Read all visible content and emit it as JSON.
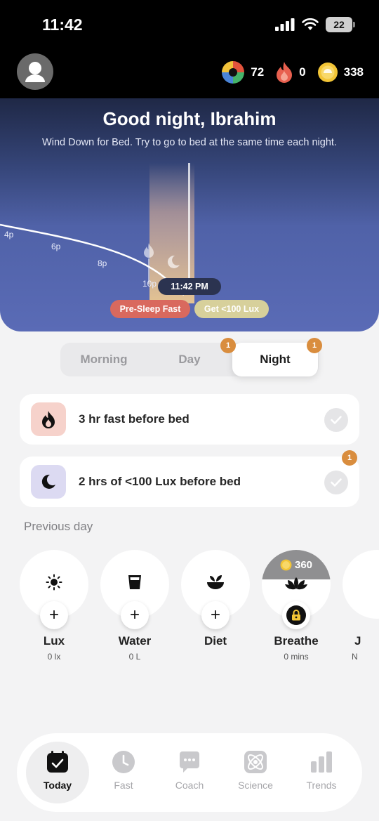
{
  "status_bar": {
    "time": "11:42",
    "battery": "22"
  },
  "header": {
    "stats": [
      {
        "icon": "color-wheel-icon",
        "value": "72"
      },
      {
        "icon": "flame-icon",
        "value": "0"
      },
      {
        "icon": "coin-icon",
        "value": "338"
      }
    ]
  },
  "hero": {
    "title": "Good night, Ibrahim",
    "subtitle": "Wind Down for Bed. Try to go to bed at the same time each night.",
    "time_labels": [
      "4p",
      "6p",
      "8p",
      "10p"
    ],
    "current_time": "11:42 PM",
    "tags": [
      "Pre-Sleep Fast",
      "Get <100 Lux"
    ]
  },
  "segment": {
    "tabs": [
      "Morning",
      "Day",
      "Night"
    ],
    "selected": "Night",
    "badges": {
      "day": "1",
      "night": "1"
    }
  },
  "tasks": [
    {
      "label": "3 hr fast before bed",
      "icon": "flame-icon"
    },
    {
      "label": "2 hrs of <100 Lux before bed",
      "icon": "moon-icon",
      "badge": "1"
    }
  ],
  "previous_day": {
    "title": "Previous day",
    "habits": [
      {
        "name": "Lux",
        "value": "0 lx",
        "icon": "sun-icon"
      },
      {
        "name": "Water",
        "value": "0 L",
        "icon": "cup-icon"
      },
      {
        "name": "Diet",
        "value": "",
        "icon": "salad-bowl-icon"
      },
      {
        "name": "Breathe",
        "value": "0 mins",
        "icon": "lotus-icon",
        "cost": "360",
        "locked": true
      },
      {
        "name": "J",
        "value": "N",
        "icon": ""
      }
    ]
  },
  "nav": {
    "items": [
      {
        "label": "Today",
        "icon": "calendar-check-icon",
        "active": true
      },
      {
        "label": "Fast",
        "icon": "clock-icon"
      },
      {
        "label": "Coach",
        "icon": "chat-bubble-icon"
      },
      {
        "label": "Science",
        "icon": "atom-icon"
      },
      {
        "label": "Trends",
        "icon": "bar-chart-icon"
      }
    ]
  },
  "colors": {
    "fast_tag": "#d9695e",
    "lux_tag": "#d7d09b",
    "badge": "#d98d3e",
    "hero_bottom": "#5a6bb6"
  }
}
